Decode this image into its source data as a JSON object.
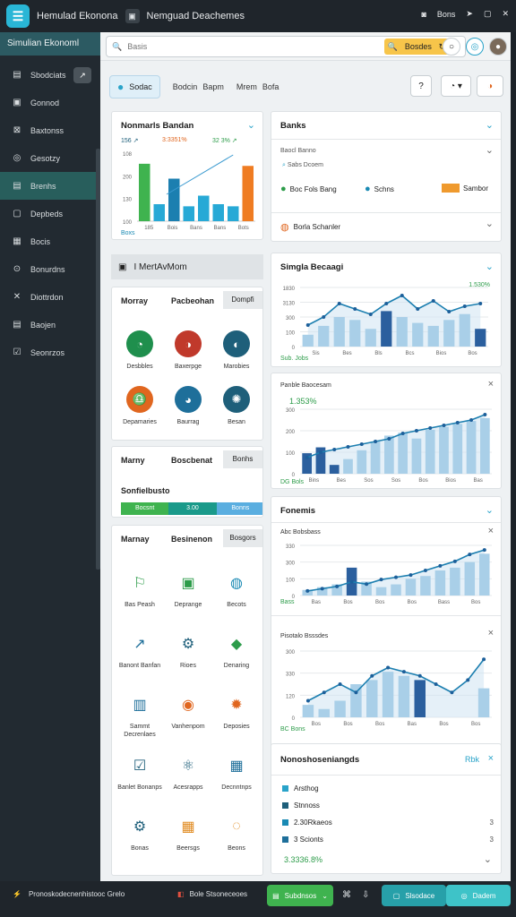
{
  "app": {
    "title": "Hemulad Ekonona",
    "doc_title": "Nemguad Deachemes",
    "user_label": "Bons"
  },
  "sidebar": {
    "header": "Simulian Ekonoml",
    "items": [
      {
        "label": "Sbodciats",
        "icon": "▤",
        "badge": "↗"
      },
      {
        "label": "Gonnod",
        "icon": "▣"
      },
      {
        "label": "Baxtonss",
        "icon": "⊠"
      },
      {
        "label": "Gesotzy",
        "icon": "◎"
      },
      {
        "label": "Brenhs",
        "icon": "▤",
        "active": true
      },
      {
        "label": "Depbeds",
        "icon": "▢"
      },
      {
        "label": "Bocis",
        "icon": "▦"
      },
      {
        "label": "Bonurdns",
        "icon": "⊙"
      },
      {
        "label": "Diottrdon",
        "icon": "✕"
      },
      {
        "label": "Baojen",
        "icon": "▤"
      },
      {
        "label": "Seonrzos",
        "icon": "☑"
      }
    ]
  },
  "topbar": {
    "search_placeholder": "Basis",
    "search_button": "Bosdes"
  },
  "toolbar": {
    "chip_label": "Sodac",
    "tabs": [
      "Bodcin",
      "Bapm",
      "Mrem",
      "Bofa"
    ]
  },
  "card_budget": {
    "title": "Nonmarls Bandan",
    "stat1": "156 ↗",
    "stat2": "3:3351%",
    "stat3": "32 3% ↗",
    "legend": "Boxs"
  },
  "chart_budget": {
    "type": "bar",
    "categories": [
      "185",
      "Bois",
      "Bans",
      "Bans",
      "Bots"
    ],
    "series": [
      {
        "values": [
          135,
          40,
          100,
          35,
          60,
          40,
          35,
          130
        ]
      },
      {
        "values": [
          38
        ]
      }
    ],
    "yticks": [
      "108",
      "200",
      "130",
      "100"
    ],
    "ylim": [
      0,
      160
    ]
  },
  "card_banks": {
    "title": "Banks",
    "sub1": "Baocl Banno",
    "sub2": "Sabs Dcoem",
    "opt1": "Boc Fols Bang",
    "opt2": "Schns",
    "opt3": "Sambor",
    "footer": "Borla Schanler"
  },
  "section_header": "I MertAvMom",
  "card_icons1": {
    "col1": "Morray",
    "col2": "Pacbeohan",
    "btn": "Dompfi",
    "items": [
      {
        "label": "Desbbles",
        "icon": "◔",
        "color": "#1f8f4d"
      },
      {
        "label": "Baxerpge",
        "icon": "◑",
        "color": "#c0392b"
      },
      {
        "label": "Marobies",
        "icon": "◐",
        "color": "#1e5f7a"
      },
      {
        "label": "Depamaries",
        "icon": "♎",
        "color": "#e0661f"
      },
      {
        "label": "Baurrag",
        "icon": "◕",
        "color": "#1e6f9a"
      },
      {
        "label": "Besan",
        "icon": "✺",
        "color": "#1e5f7a"
      }
    ]
  },
  "card_summary": {
    "col1": "Marny",
    "col2": "Boscbenat",
    "btn": "Bonhs",
    "label": "Sonfielbusto",
    "bar": [
      "Bocsnt",
      "3.00",
      "Bonns"
    ]
  },
  "card_icons2": {
    "col1": "Marnay",
    "col2": "Besinenon",
    "btn": "Bosgors",
    "items": [
      {
        "label": "Bas Peash",
        "icon": "⚐",
        "color": "#2d9c4a"
      },
      {
        "label": "Deprange",
        "icon": "▣",
        "color": "#2d9c4a"
      },
      {
        "label": "Becots",
        "icon": "◍",
        "color": "#1a8ab4"
      },
      {
        "label": "Banont Banfan",
        "icon": "↗",
        "color": "#1e6f9a"
      },
      {
        "label": "Rioes",
        "icon": "⚙",
        "color": "#1e5f7a"
      },
      {
        "label": "Denaring",
        "icon": "◆",
        "color": "#2d9c4a"
      },
      {
        "label": "Sammt Decrenlaes",
        "icon": "▥",
        "color": "#1e6f9a"
      },
      {
        "label": "Vanhenpom",
        "icon": "◉",
        "color": "#e0661f"
      },
      {
        "label": "Deposies",
        "icon": "✹",
        "color": "#e0661f"
      },
      {
        "label": "Banlet Bonanps",
        "icon": "☑",
        "color": "#1e5f7a"
      },
      {
        "label": "Acesrapps",
        "icon": "⚛",
        "color": "#1e5f7a"
      },
      {
        "label": "Decnntnps",
        "icon": "▦",
        "color": "#1e6f9a"
      },
      {
        "label": "Bonas",
        "icon": "⚙",
        "color": "#1e5f7a"
      },
      {
        "label": "Beersgs",
        "icon": "▦",
        "color": "#e08a1f"
      },
      {
        "label": "Beons",
        "icon": "◌",
        "color": "#e08a1f"
      }
    ]
  },
  "chart_simple": {
    "title": "Simgla Becaagi",
    "badge": "1.530%",
    "type": "bar",
    "categories": [
      "Sis",
      "Bes",
      "Bls",
      "Bcs",
      "Bios",
      "Bos"
    ],
    "values": [
      20,
      35,
      50,
      45,
      30,
      60,
      50,
      40,
      35,
      45,
      55,
      30
    ],
    "line": [
      40,
      55,
      80,
      70,
      60,
      80,
      95,
      70,
      85,
      65,
      75,
      80
    ],
    "yticks": [
      "1830",
      "3130",
      "300",
      "100",
      "0"
    ],
    "legend": "Sub. Jobs"
  },
  "chart_balance": {
    "title": "Panble Baocesam",
    "badge": "1.353%",
    "type": "bar",
    "categories": [
      "Bins",
      "Bes",
      "Sos",
      "Sos",
      "Bos",
      "Bios",
      "Bas"
    ],
    "values": [
      35,
      45,
      15,
      25,
      40,
      55,
      65,
      70,
      60,
      75,
      80,
      85,
      90,
      95
    ],
    "line": [
      30,
      40,
      45,
      50,
      55,
      60,
      65,
      75,
      80,
      85,
      90,
      95,
      100,
      110
    ],
    "yticks": [
      "300",
      "200",
      "100",
      "0"
    ],
    "legend": "DG Bols"
  },
  "card_fonemis": {
    "title": "Fonemis"
  },
  "chart_mid": {
    "title": "Abc Bobsbass",
    "type": "bar",
    "categories": [
      "Bas",
      "Bos",
      "Bos",
      "Bos",
      "Bass",
      "Bos"
    ],
    "values": [
      10,
      15,
      20,
      50,
      25,
      15,
      20,
      30,
      35,
      45,
      50,
      60,
      75
    ],
    "line": [
      10,
      15,
      20,
      30,
      25,
      35,
      40,
      45,
      55,
      65,
      75,
      90,
      100
    ],
    "yticks": [
      "330",
      "300",
      "100",
      "0"
    ],
    "legend": "Bass"
  },
  "chart_second": {
    "title": "Pisotalo Bsssdes",
    "type": "bar",
    "categories": [
      "Bos",
      "Bos",
      "Bos",
      "Bas",
      "Bos",
      "Bos"
    ],
    "values": [
      15,
      10,
      20,
      40,
      45,
      55,
      50,
      45,
      0,
      0,
      0,
      35
    ],
    "line": [
      20,
      30,
      40,
      30,
      50,
      60,
      55,
      50,
      40,
      30,
      45,
      70
    ],
    "yticks": [
      "300",
      "330",
      "120",
      "0"
    ],
    "legend": "BC Bons"
  },
  "card_notes": {
    "title": "Nonoshoseniangds",
    "tag": "Rbk",
    "rows": [
      "Arsthog",
      "Stnnoss",
      "2.30Rkaeos",
      "3 Scionts"
    ],
    "nums": [
      "",
      "",
      "3",
      "3"
    ],
    "total": "3.3336.8%"
  },
  "footer": {
    "status": "Pronoskodecnenhistooc Grelo",
    "mid": "Bole Stsoneceoes",
    "btn_green": "Subdnsos",
    "btn_teal1": "Slsodace",
    "btn_teal2": "Dadem"
  }
}
